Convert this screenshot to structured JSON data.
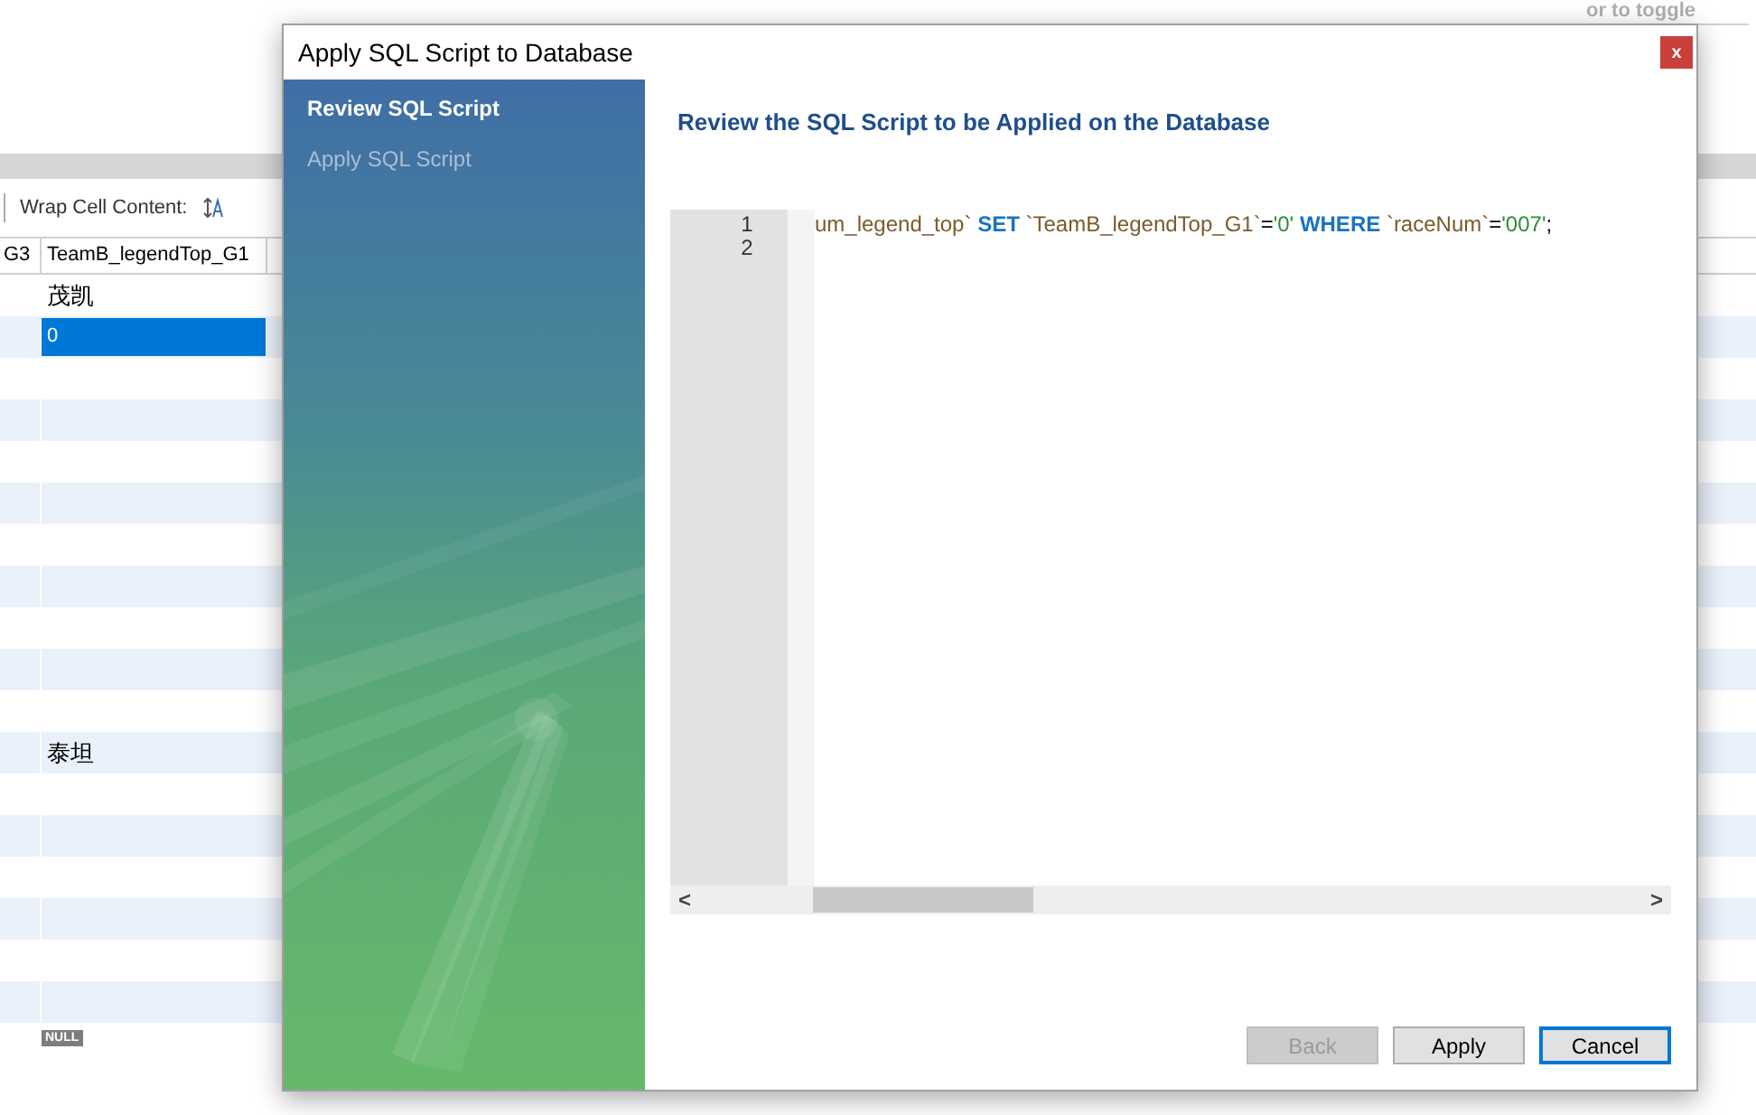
{
  "background": {
    "hint": "or to toggle",
    "toolbar": {
      "label": "Wrap Cell Content:"
    },
    "columns": [
      "G3",
      "TeamB_legendTop_G1"
    ],
    "rows": [
      {
        "cell": "茂凯",
        "selected": false
      },
      {
        "cell": "0",
        "selected": true
      },
      {
        "selected": false
      },
      {
        "selected": false
      },
      {
        "selected": false
      },
      {
        "selected": false
      },
      {
        "selected": false
      },
      {
        "selected": false
      },
      {
        "selected": false
      },
      {
        "selected": false
      },
      {
        "selected": false
      },
      {
        "cell": "泰坦",
        "selected": false
      },
      {
        "selected": false
      },
      {
        "selected": false
      },
      {
        "selected": false
      },
      {
        "selected": false
      },
      {
        "selected": false
      },
      {
        "selected": false
      }
    ],
    "null_badges": [
      "NULL"
    ]
  },
  "dialog": {
    "title": "Apply SQL Script to Database",
    "close": "x",
    "steps": [
      {
        "label": "Review SQL Script",
        "selected": true
      },
      {
        "label": "Apply SQL Script",
        "selected": false
      }
    ],
    "heading": "Review the SQL Script to be Applied on the Database",
    "editor": {
      "lines": [
        {
          "number": "1",
          "tokens": [
            {
              "kind": "ident",
              "text": "um_legend_top`"
            },
            {
              "kind": "keyword",
              "text": " SET"
            },
            {
              "kind": "ident",
              "text": " `TeamB_legendTop_G1`"
            },
            {
              "kind": "plain",
              "text": "="
            },
            {
              "kind": "string",
              "text": "'0'"
            },
            {
              "kind": "keyword",
              "text": " WHERE"
            },
            {
              "kind": "ident",
              "text": " `raceNum`"
            },
            {
              "kind": "plain",
              "text": "="
            },
            {
              "kind": "string",
              "text": "'007'"
            },
            {
              "kind": "plain",
              "text": ";"
            }
          ]
        },
        {
          "number": "2"
        }
      ],
      "scroll_left": "<",
      "scroll_right": ">"
    },
    "buttons": [
      {
        "label": "Back",
        "disabled": true,
        "focused": false
      },
      {
        "label": "Apply",
        "disabled": false,
        "focused": false
      },
      {
        "label": "Cancel",
        "disabled": false,
        "focused": true
      }
    ]
  }
}
